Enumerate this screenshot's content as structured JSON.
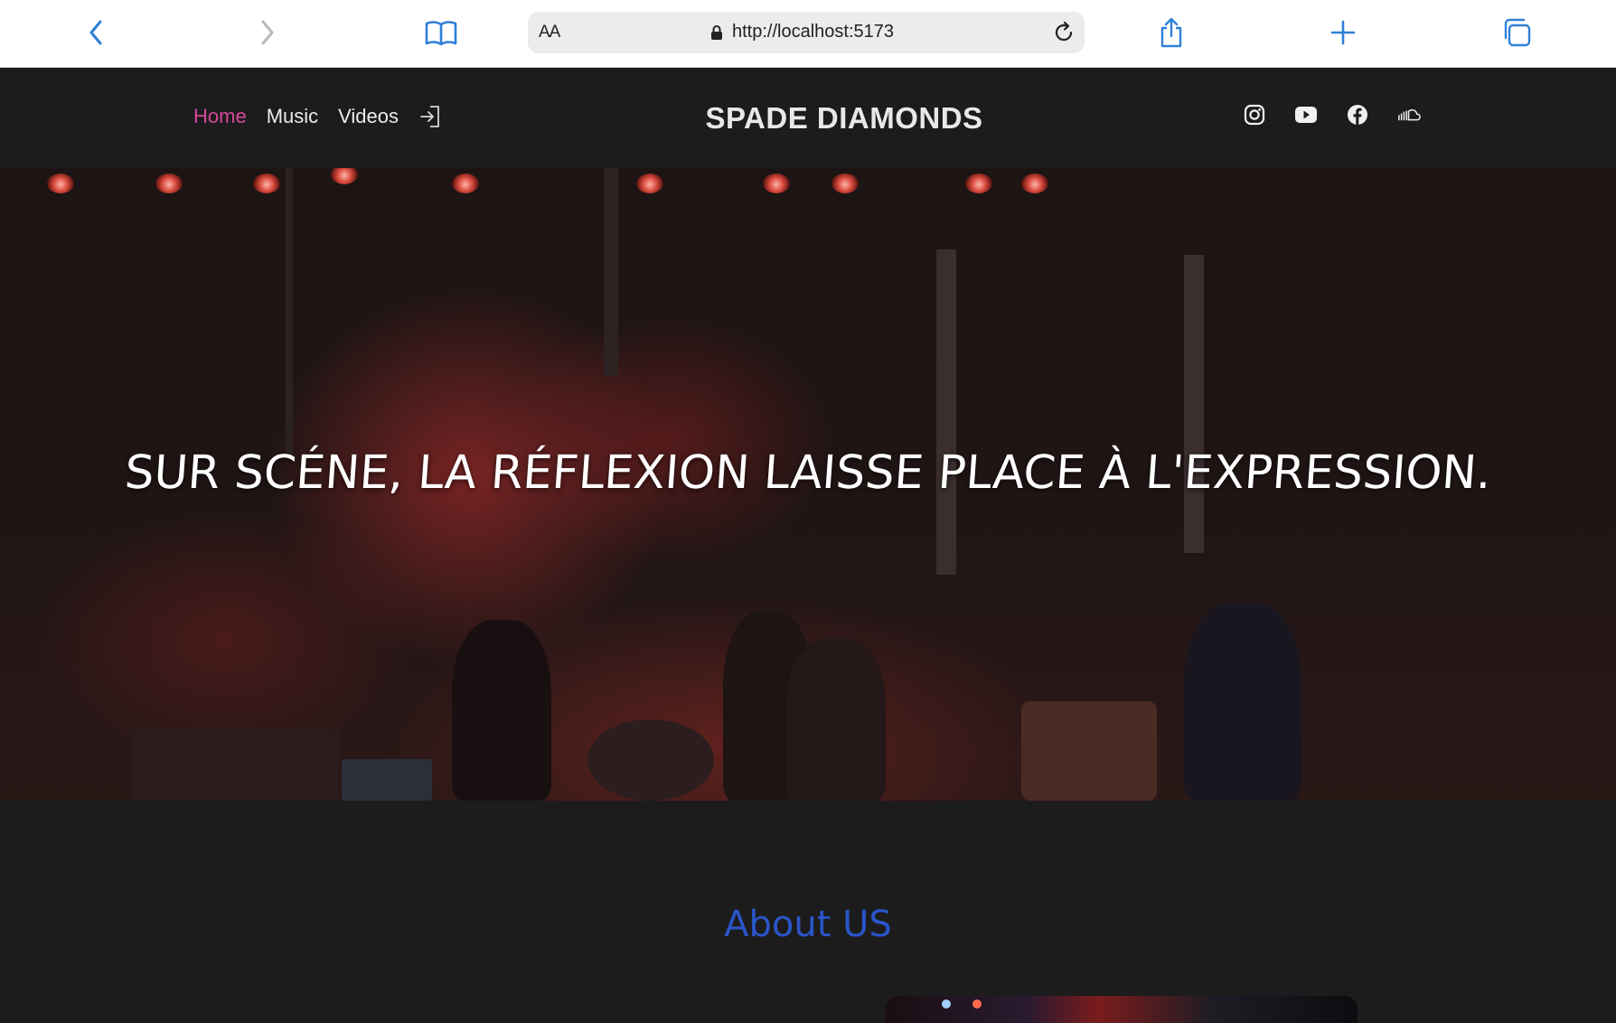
{
  "browser": {
    "reader_label": "AA",
    "url": "http://localhost:5173",
    "accent": "#2f80d8"
  },
  "site": {
    "brand": "SPADE DIAMONDS",
    "nav": [
      {
        "label": "Home",
        "active": true
      },
      {
        "label": "Music",
        "active": false
      },
      {
        "label": "Videos",
        "active": false
      }
    ],
    "social_icons": [
      "instagram-icon",
      "youtube-icon",
      "facebook-icon",
      "soundcloud-icon"
    ],
    "active_color": "#d6479a"
  },
  "hero": {
    "title": "SUR SCÉNE, LA RÉFLEXION LAISSE PLACE À L'EXPRESSION."
  },
  "about": {
    "title": "About US",
    "title_color": "#2a55c9"
  }
}
